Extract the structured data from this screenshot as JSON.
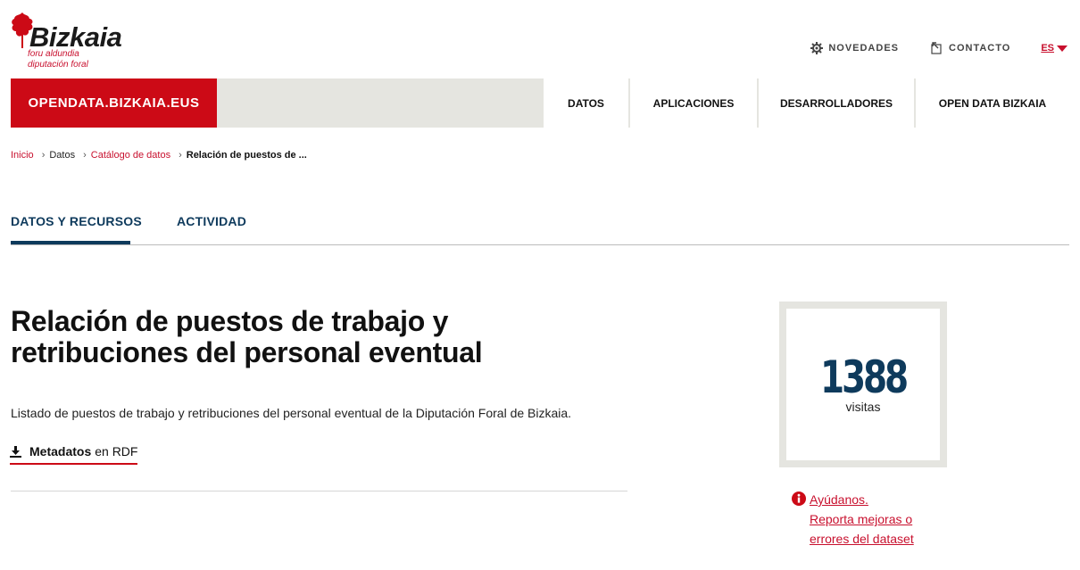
{
  "header": {
    "logo_word": "Bizkaia",
    "logo_sub1": "foru aldundia",
    "logo_sub2": "diputación foral",
    "links": [
      {
        "label": "NOVEDADES",
        "icon": "gear-icon"
      },
      {
        "label": "CONTACTO",
        "icon": "external-link-icon"
      }
    ],
    "language": "ES"
  },
  "nav": {
    "brand": "OPENDATA.BIZKAIA.EUS",
    "items": [
      "DATOS",
      "APLICACIONES",
      "DESARROLLADORES",
      "OPEN DATA BIZKAIA"
    ]
  },
  "breadcrumb": {
    "items": [
      "Inicio",
      "Datos",
      "Catálogo de datos",
      "Relación de puestos de ..."
    ]
  },
  "tabs": [
    "DATOS Y RECURSOS",
    "ACTIVIDAD"
  ],
  "dataset": {
    "title": "Relación de puestos de trabajo y retribuciones del personal eventual",
    "description": "Listado de puestos de trabajo y retribuciones del personal eventual de la Diputación Foral de Bizkaia.",
    "metadata_bold": "Metadatos",
    "metadata_rest": "en RDF"
  },
  "visits": {
    "count": "1388",
    "label": "visitas"
  },
  "help": {
    "line1": "Ayúdanos.",
    "line2": "Reporta mejoras o",
    "line3": "errores del dataset"
  },
  "colors": {
    "brand_red": "#cc0a16",
    "navy": "#0e3a5c",
    "nav_gray": "#e5e5e0"
  }
}
